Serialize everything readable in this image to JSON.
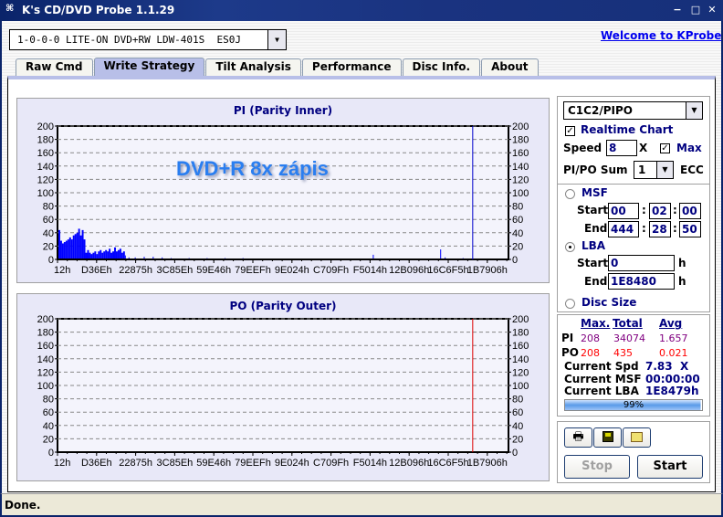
{
  "window": {
    "title": "K's CD/DVD Probe 1.1.29",
    "minimize": "−",
    "maximize": "□",
    "close": "✕"
  },
  "drive": {
    "selected": "1-0-0-0 LITE-ON DVD+RW LDW-401S  ES0J"
  },
  "welcome_link": "Welcome to KProbe",
  "tabs": [
    {
      "label": "Raw Cmd",
      "active": false
    },
    {
      "label": "Write Strategy",
      "active": true
    },
    {
      "label": "Tilt Analysis",
      "active": false
    },
    {
      "label": "Performance",
      "active": false
    },
    {
      "label": "Disc Info.",
      "active": false
    },
    {
      "label": "About",
      "active": false
    }
  ],
  "overlay_text": "DVD+R 8x zápis",
  "chart_data": [
    {
      "type": "bar",
      "title": "PI (Parity Inner)",
      "color": "#0000ff",
      "marker_color": "#0000cc",
      "ylim": [
        0,
        200
      ],
      "yticks": [
        0,
        20,
        40,
        60,
        80,
        100,
        120,
        140,
        160,
        180,
        200
      ],
      "xticks": [
        "12h",
        "D36Eh",
        "22875h",
        "3C85Eh",
        "59E46h",
        "79EEFh",
        "9E024h",
        "C709Fh",
        "F5014h",
        "12B096h",
        "16C6F5h",
        "1B7906h"
      ],
      "grid": true,
      "progress_marker_fraction": 0.99,
      "values_fraction_x_y": [
        [
          0.0,
          44
        ],
        [
          0.004,
          28
        ],
        [
          0.008,
          24
        ],
        [
          0.012,
          26
        ],
        [
          0.016,
          28
        ],
        [
          0.02,
          30
        ],
        [
          0.024,
          33
        ],
        [
          0.028,
          30
        ],
        [
          0.032,
          36
        ],
        [
          0.036,
          38
        ],
        [
          0.04,
          40
        ],
        [
          0.044,
          46
        ],
        [
          0.048,
          36
        ],
        [
          0.052,
          44
        ],
        [
          0.056,
          30
        ],
        [
          0.06,
          10
        ],
        [
          0.064,
          14
        ],
        [
          0.068,
          10
        ],
        [
          0.072,
          8
        ],
        [
          0.076,
          10
        ],
        [
          0.08,
          12
        ],
        [
          0.084,
          8
        ],
        [
          0.088,
          12
        ],
        [
          0.092,
          14
        ],
        [
          0.096,
          10
        ],
        [
          0.1,
          12
        ],
        [
          0.104,
          14
        ],
        [
          0.108,
          12
        ],
        [
          0.112,
          16
        ],
        [
          0.116,
          10
        ],
        [
          0.12,
          12
        ],
        [
          0.124,
          18
        ],
        [
          0.128,
          12
        ],
        [
          0.132,
          14
        ],
        [
          0.136,
          16
        ],
        [
          0.14,
          10
        ],
        [
          0.144,
          12
        ],
        [
          0.148,
          6
        ],
        [
          0.156,
          3
        ],
        [
          0.17,
          3
        ],
        [
          0.19,
          4
        ],
        [
          0.21,
          4
        ],
        [
          0.23,
          3
        ],
        [
          0.25,
          2
        ],
        [
          0.29,
          2
        ],
        [
          0.33,
          2
        ],
        [
          0.37,
          2
        ],
        [
          0.41,
          2
        ],
        [
          0.45,
          1
        ],
        [
          0.5,
          1
        ],
        [
          0.6,
          1
        ],
        [
          0.7,
          7
        ],
        [
          0.72,
          1
        ],
        [
          0.8,
          1
        ],
        [
          0.85,
          15
        ],
        [
          0.86,
          3
        ],
        [
          0.9,
          2
        ],
        [
          0.94,
          1
        ]
      ]
    },
    {
      "type": "bar",
      "title": "PO (Parity Outer)",
      "color": "#ff0000",
      "marker_color": "#dd0000",
      "ylim": [
        0,
        200
      ],
      "yticks": [
        0,
        20,
        40,
        60,
        80,
        100,
        120,
        140,
        160,
        180,
        200
      ],
      "xticks": [
        "12h",
        "D36Eh",
        "22875h",
        "3C85Eh",
        "59E46h",
        "79EEFh",
        "9E024h",
        "C709Fh",
        "F5014h",
        "12B096h",
        "16C6F5h",
        "1B7906h"
      ],
      "grid": true,
      "progress_marker_fraction": 0.99,
      "values_fraction_x_y": [
        [
          0.05,
          1
        ],
        [
          0.055,
          1
        ],
        [
          0.3,
          1
        ]
      ]
    }
  ],
  "side": {
    "mode_select": "C1C2/PIPO",
    "realtime_chart_label": "Realtime Chart",
    "realtime_chart_checked": true,
    "speed_label": "Speed",
    "speed_value": "8",
    "speed_unit": "X",
    "max_label": "Max",
    "max_checked": true,
    "pipo_sum_label": "PI/PO Sum",
    "pipo_sum_value": "1",
    "ecc_label": "ECC",
    "msf_label": "MSF",
    "msf_checked": false,
    "start_label": "Start",
    "end_label": "End",
    "msf_start": [
      "00",
      "02",
      "00"
    ],
    "msf_end": [
      "444",
      "28",
      "50"
    ],
    "sep": ":",
    "lba_label": "LBA",
    "lba_checked": true,
    "lba_start": "0",
    "lba_end": "1E8480",
    "hex_unit": "h",
    "disc_size_label": "Disc Size",
    "disc_size_checked": false
  },
  "stats": {
    "headers": [
      "Max.",
      "Total",
      "Avg"
    ],
    "pi": {
      "label": "PI",
      "max": "208",
      "total": "34074",
      "avg": "1.657"
    },
    "po": {
      "label": "PO",
      "max": "208",
      "total": "435",
      "avg": "0.021"
    },
    "current_spd_label": "Current Spd",
    "current_spd": "7.83  X",
    "current_msf_label": "Current MSF",
    "current_msf": "00:00:00",
    "current_lba_label": "Current LBA",
    "current_lba": "1E8479h",
    "progress_percent": 99,
    "progress_text": "99%"
  },
  "buttons": {
    "print_icon": "🖶",
    "save_icon": "💾",
    "export_icon": "🖼",
    "stop": "Stop",
    "start": "Start"
  },
  "status": "Done."
}
